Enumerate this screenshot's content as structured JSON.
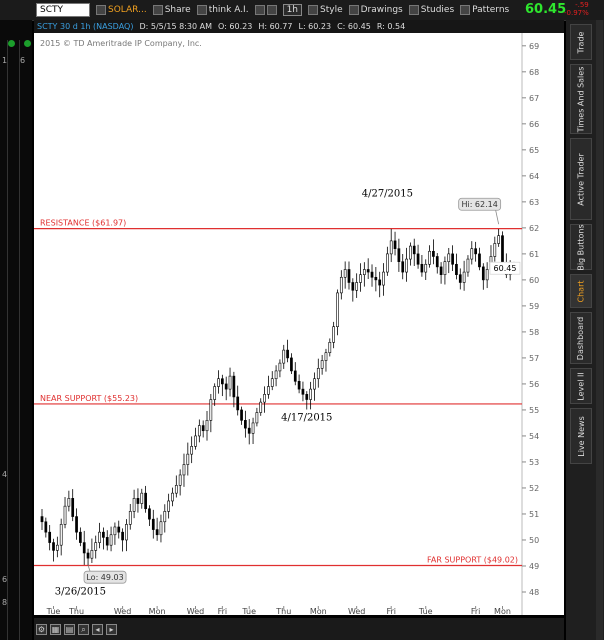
{
  "toolbar": {
    "symbol": "SCTY",
    "company": "SOLAR...",
    "share": "Share",
    "think_ai": "think A.I.",
    "timeframe": "1h",
    "style": "Style",
    "drawings": "Drawings",
    "studies": "Studies",
    "patterns": "Patterns",
    "last_price": "60.45",
    "change": "-.59",
    "change_pct": "-0.97%"
  },
  "infobar": {
    "symbol_desc": "SCTY 30 d 1h (NASDAQ)",
    "date": "D: 5/5/15 8:30 AM",
    "open": "O: 60.23",
    "high": "H: 60.77",
    "low": "L: 60.23",
    "close": "C: 60.45",
    "range": "R: 0.54"
  },
  "left_numbers": [
    "1",
    "6",
    "4",
    "6",
    "8"
  ],
  "right_tabs": [
    "Trade",
    "Times And Sales",
    "Active Trader",
    "Big Buttons",
    "Chart",
    "Dashboard",
    "Level II",
    "Live News"
  ],
  "active_tab": "Chart",
  "colors": {
    "up_price": "#2ee62e",
    "down_price": "#e02020",
    "line_red": "#e03030",
    "candles": "#000000",
    "accent": "#f0a020"
  },
  "chart_data": {
    "type": "candlestick",
    "copyright": "2015 © TD Ameritrade IP Company, Inc.",
    "y_ticks": [
      "48",
      "49",
      "50",
      "51",
      "52",
      "53",
      "54",
      "55",
      "56",
      "57",
      "58",
      "59",
      "60",
      "61",
      "62",
      "63",
      "64",
      "65",
      "66",
      "67",
      "68",
      "69"
    ],
    "ylim": [
      47.5,
      69.3
    ],
    "x_ticks": [
      "Tue",
      "Thu",
      "Wed",
      "Mon",
      "Wed",
      "Fri",
      "Tue",
      "Thu",
      "Mon",
      "Wed",
      "Fri",
      "Tue",
      "Fri",
      "Mon"
    ],
    "x_tick_index": [
      3,
      9,
      21,
      30,
      40,
      47,
      54,
      63,
      72,
      82,
      91,
      100,
      113,
      120
    ],
    "n_bars": 124,
    "horizontal_lines": [
      {
        "label": "RESISTANCE ($61.97)",
        "value": 61.97,
        "align": "left"
      },
      {
        "label": "NEAR SUPPORT ($55.23)",
        "value": 55.23,
        "align": "left"
      },
      {
        "label": "FAR SUPPORT ($49.02)",
        "value": 49.02,
        "align": "right"
      }
    ],
    "annotations": [
      {
        "text": "4/27/2015",
        "bar": 90,
        "value": 63.2
      },
      {
        "text": "4/17/2015",
        "bar": 69,
        "value": 54.6
      },
      {
        "text": "3/26/2015",
        "bar": 10,
        "value": 47.9
      }
    ],
    "hi_bubble": {
      "text": "Hi: 62.14",
      "bar": 119,
      "value": 62.14
    },
    "lo_bubble": {
      "text": "Lo: 49.03",
      "bar": 12,
      "value": 49.03
    },
    "last_label": {
      "text": "60.45",
      "value": 60.45
    },
    "closes": [
      50.7,
      50.3,
      49.9,
      49.6,
      49.8,
      50.6,
      51.3,
      51.6,
      50.9,
      50.3,
      49.9,
      49.5,
      49.3,
      49.6,
      49.9,
      50.3,
      50.1,
      49.8,
      50.2,
      50.5,
      50.3,
      50.0,
      50.6,
      51.1,
      51.6,
      51.4,
      51.8,
      51.2,
      50.8,
      50.4,
      50.2,
      50.7,
      51.1,
      51.5,
      51.8,
      52.1,
      52.5,
      52.9,
      53.3,
      53.6,
      54.0,
      54.4,
      54.2,
      54.6,
      55.4,
      55.9,
      56.2,
      56.0,
      55.8,
      56.3,
      55.5,
      55.0,
      54.6,
      54.3,
      54.1,
      54.5,
      54.9,
      55.3,
      55.6,
      55.9,
      56.2,
      56.5,
      56.8,
      57.3,
      57.0,
      56.5,
      56.1,
      55.8,
      55.6,
      55.4,
      55.8,
      56.2,
      56.6,
      56.9,
      57.2,
      57.6,
      58.2,
      59.5,
      60.1,
      60.4,
      59.9,
      59.6,
      59.9,
      60.2,
      60.4,
      60.3,
      60.1,
      60.0,
      59.8,
      60.3,
      61.0,
      61.5,
      61.2,
      60.7,
      60.3,
      60.8,
      61.3,
      61.0,
      60.6,
      60.3,
      60.6,
      61.1,
      60.9,
      60.5,
      60.2,
      60.7,
      61.0,
      60.6,
      60.2,
      59.9,
      60.3,
      60.8,
      61.2,
      61.0,
      60.5,
      60.0,
      60.4,
      60.9,
      61.4,
      61.7,
      60.6,
      60.2,
      60.45,
      60.45
    ]
  }
}
